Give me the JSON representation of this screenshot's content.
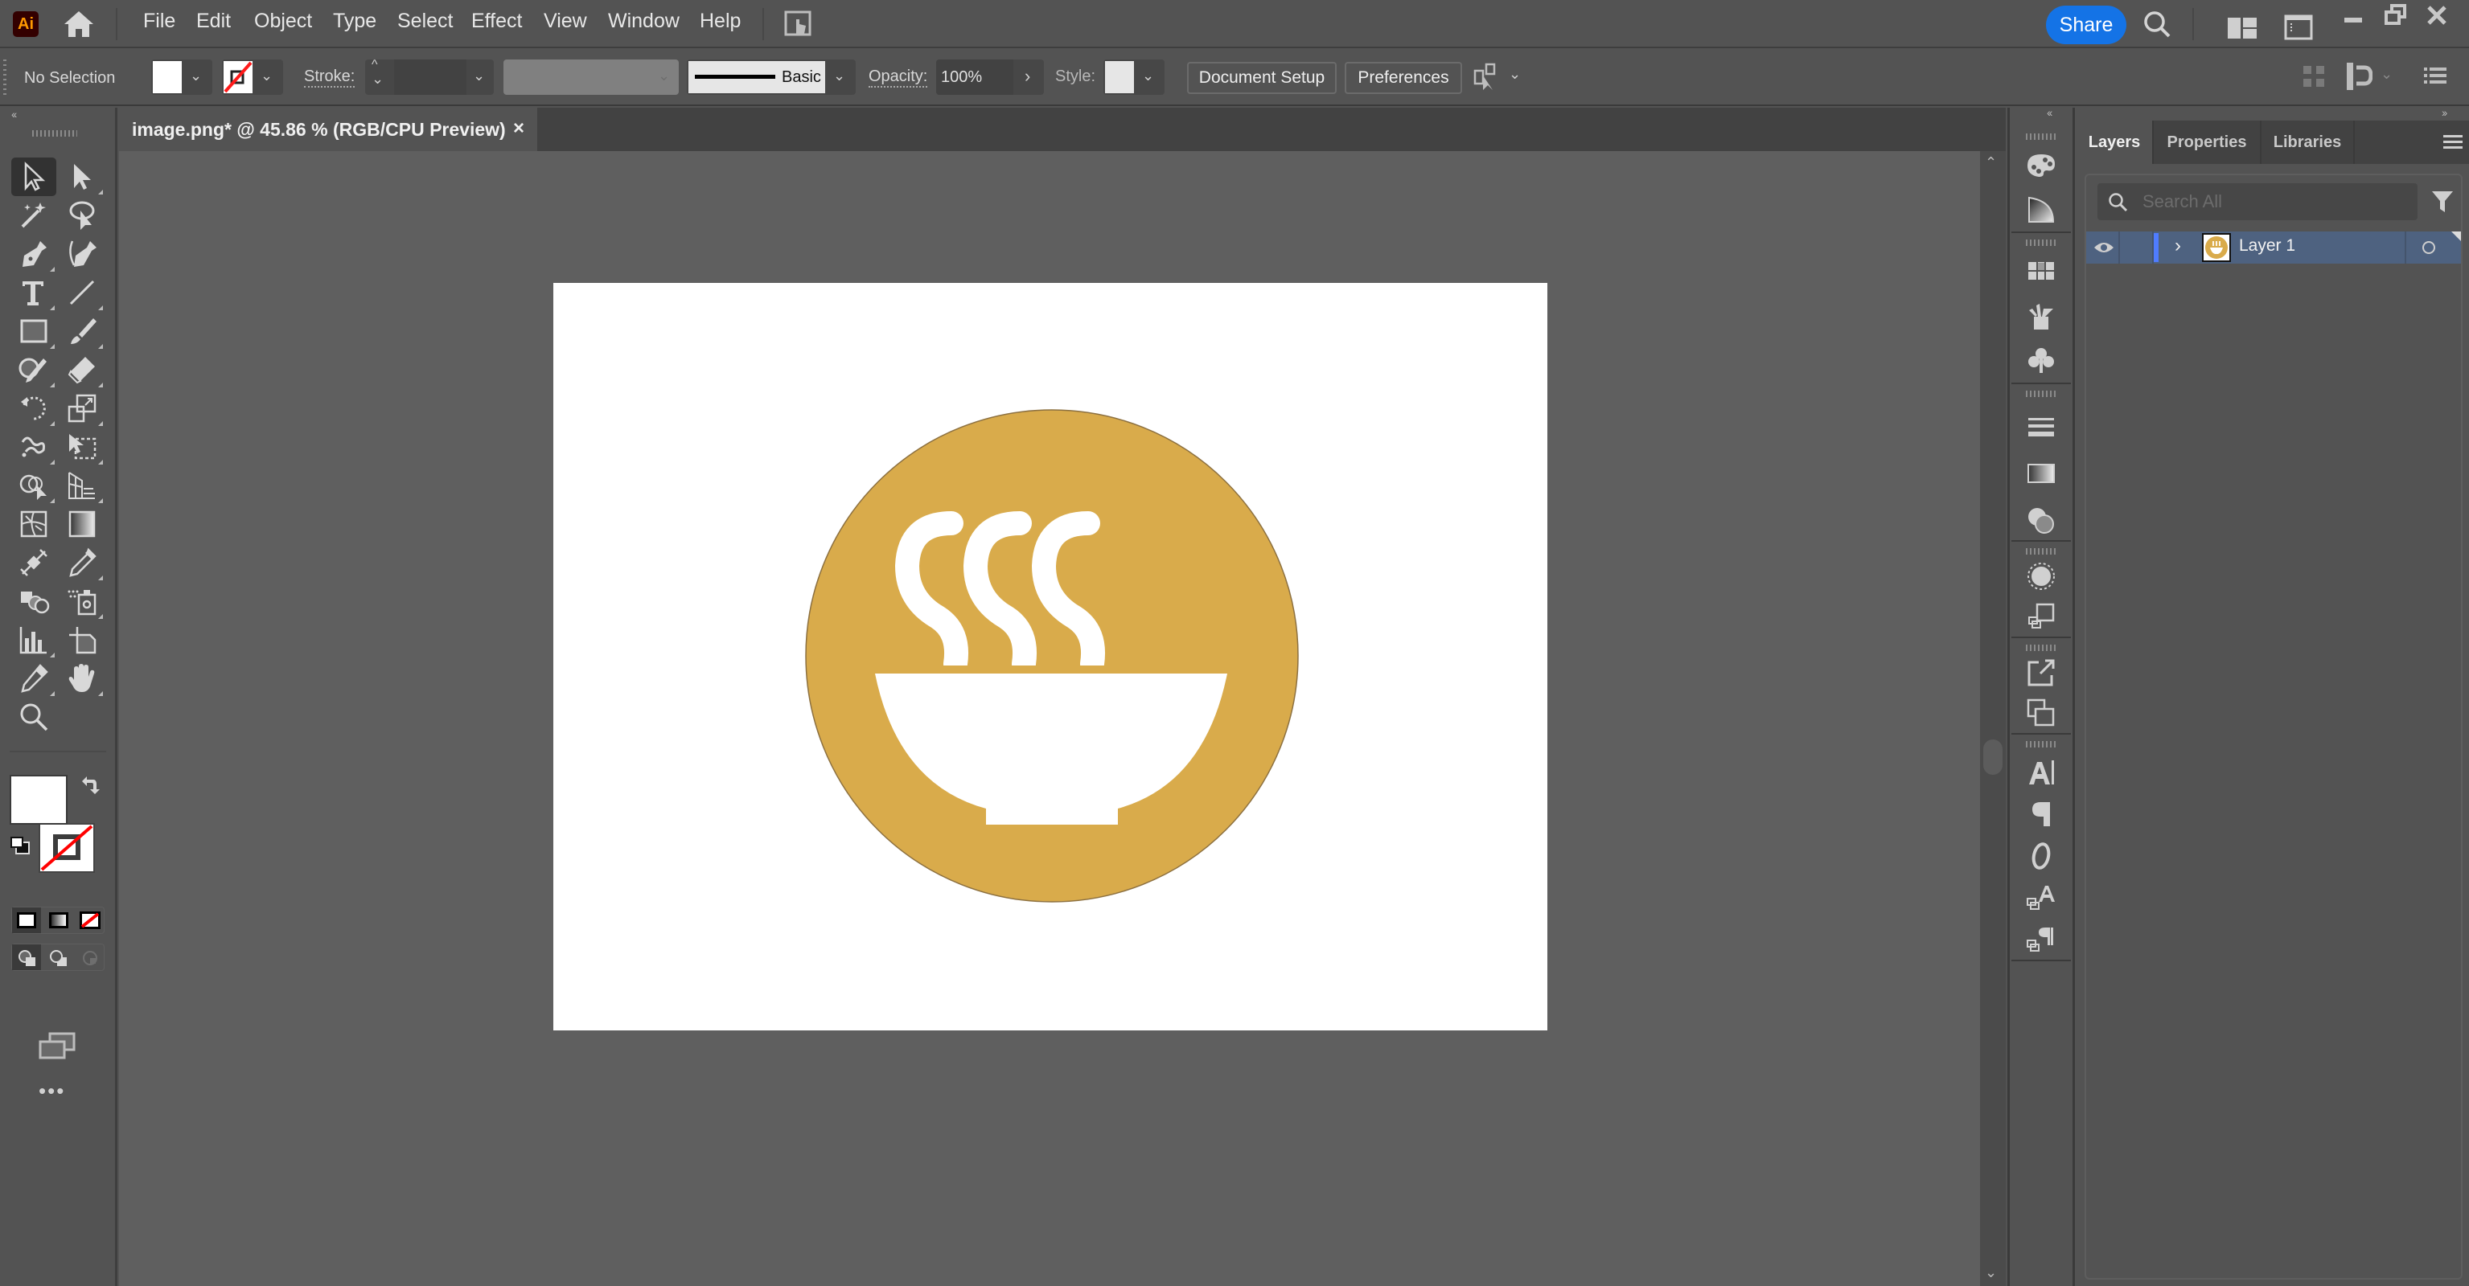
{
  "app": {
    "logo_text": "Ai",
    "menu": [
      "File",
      "Edit",
      "Object",
      "Type",
      "Select",
      "Effect",
      "View",
      "Window",
      "Help"
    ],
    "share_label": "Share",
    "brand_color": "#1473e6",
    "logo_color": "#ff9a00"
  },
  "control_bar": {
    "selection_status": "No Selection",
    "stroke_label": "Stroke:",
    "stroke_weight": "",
    "brush_profile": "Basic",
    "opacity_label": "Opacity:",
    "opacity_value": "100%",
    "style_label": "Style:",
    "document_setup_label": "Document Setup",
    "preferences_label": "Preferences"
  },
  "document": {
    "tab_title": "image.png* @ 45.86 % (RGB/CPU Preview)",
    "zoom_percent": "45.86 %",
    "color_mode": "RGB/CPU Preview"
  },
  "artwork": {
    "description": "Steaming bowl icon",
    "circle_color": "#d9ab4b",
    "glyph_color": "#ffffff",
    "artboard_color": "#ffffff"
  },
  "left_toolbar": {
    "tools": [
      "selection-tool",
      "direct-selection-tool",
      "magic-wand-tool",
      "lasso-tool",
      "pen-tool",
      "curvature-tool",
      "type-tool",
      "line-segment-tool",
      "rectangle-tool",
      "paintbrush-tool",
      "shaper-tool",
      "eraser-tool",
      "rotate-tool",
      "scale-tool",
      "warp-tool",
      "free-transform-tool",
      "shape-builder-tool",
      "perspective-grid-tool",
      "mesh-tool",
      "gradient-tool",
      "width-tool",
      "eyedropper-tool",
      "blend-tool",
      "symbol-sprayer-tool",
      "column-graph-tool",
      "artboard-tool",
      "slice-tool",
      "hand-tool",
      "zoom-tool"
    ],
    "fill_color": "#ffffff",
    "stroke": "none",
    "more_label": "•••"
  },
  "right_strip": {
    "groups": [
      [
        "color-panel",
        "color-guide-panel"
      ],
      [
        "swatches-panel",
        "brushes-panel",
        "symbols-panel"
      ],
      [
        "stroke-panel",
        "gradient-panel",
        "transparency-panel"
      ],
      [
        "appearance-panel",
        "graphic-styles-panel"
      ],
      [
        "export-panel",
        "artboards-panel"
      ],
      [
        "character-panel",
        "paragraph-panel",
        "opentype-panel",
        "character-styles-panel",
        "paragraph-styles-panel"
      ]
    ]
  },
  "layers_panel": {
    "tabs": [
      "Layers",
      "Properties",
      "Libraries"
    ],
    "active_tab": "Layers",
    "search_placeholder": "Search All",
    "layers": [
      {
        "name": "Layer 1",
        "visible": true,
        "expanded": false,
        "color": "#4f7cff"
      }
    ]
  }
}
